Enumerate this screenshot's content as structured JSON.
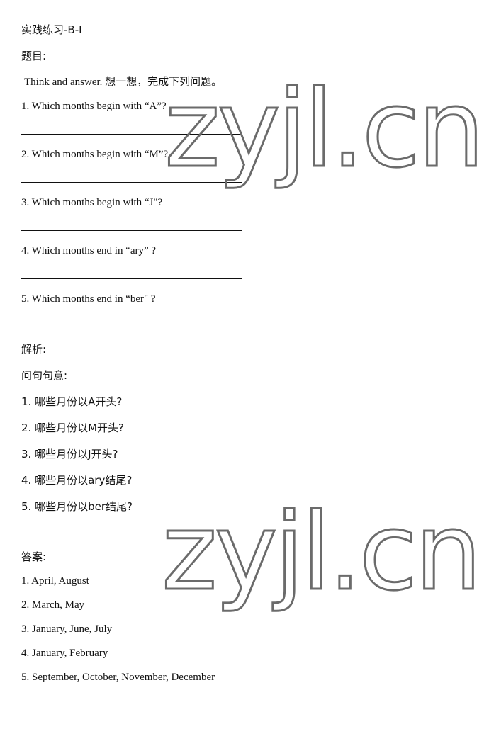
{
  "document": {
    "title": "实践练习-B-I",
    "question_heading": "题目:",
    "instruction": "Think and answer. 想一想，完成下列问题。",
    "questions": [
      "1. Which months begin with “A”?",
      "2. Which months begin with “M”?",
      "3. Which months begin with “J\"?",
      "4. Which months end in “ary” ?",
      "5. Which months end in “ber\" ?"
    ],
    "analysis_heading": "解析:",
    "analysis_subheading": "问句句意:",
    "analysis_items": [
      "1. 哪些月份以A开头?",
      "2. 哪些月份以M开头?",
      "3. 哪些月份以J开头?",
      "4. 哪些月份以ary结尾?",
      "5. 哪些月份以ber结尾?"
    ],
    "answer_heading": "答案:",
    "answers": [
      "1. April, August",
      "2. March, May",
      "3. January, June, July",
      "4. January, February",
      "5. September, October, November, December"
    ]
  },
  "watermark": {
    "text": "zyjl.cn",
    "color": "#6b6b6b"
  }
}
